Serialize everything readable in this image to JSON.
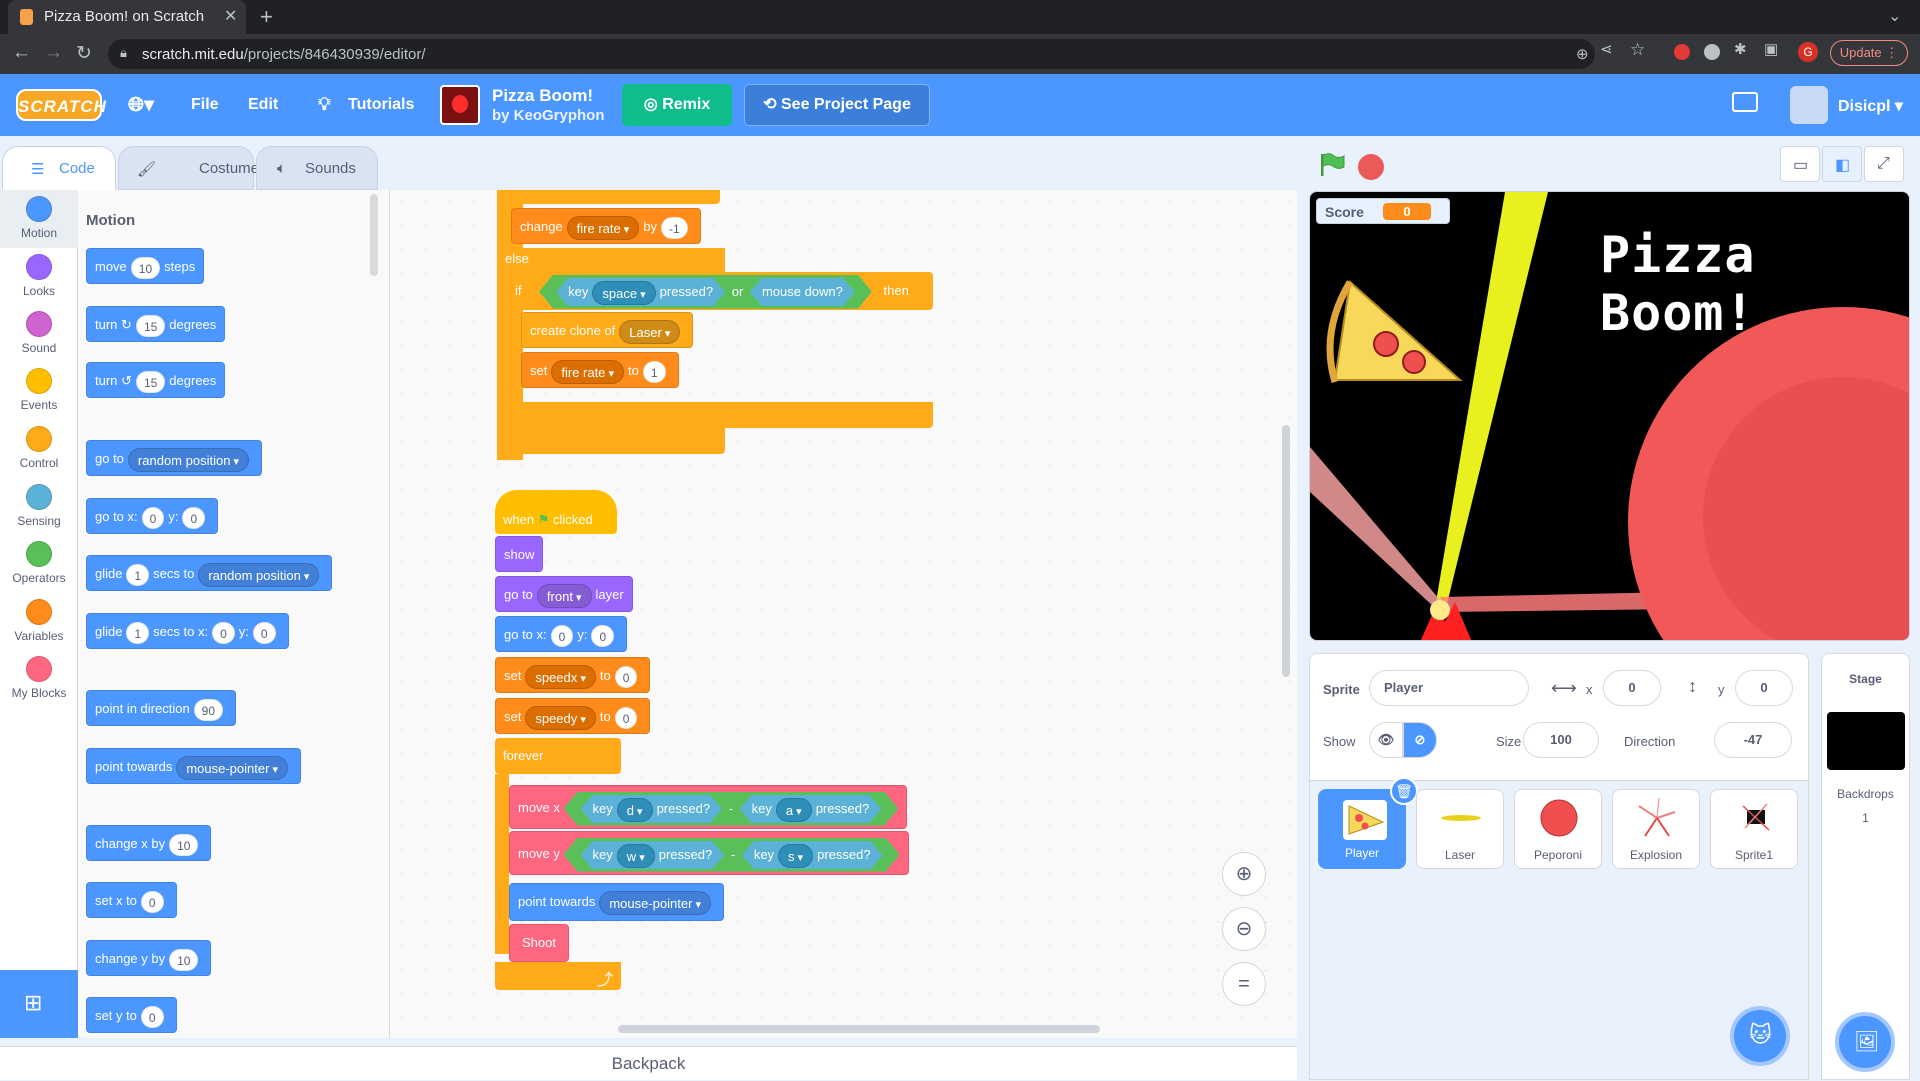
{
  "browser": {
    "tab_title": "Pizza Boom! on Scratch",
    "url_host": "scratch.mit.edu",
    "url_path": "/projects/846430939/editor/",
    "update_label": "Update",
    "profile_initial": "G"
  },
  "menu": {
    "logo": "SCRATCH",
    "file": "File",
    "edit": "Edit",
    "tutorials": "Tutorials",
    "project_title": "Pizza Boom!",
    "project_author": "by KeoGryphon",
    "remix": "Remix",
    "see_project": "See Project Page",
    "username": "Disicpl"
  },
  "editor_tabs": {
    "code": "Code",
    "costumes": "Costumes",
    "sounds": "Sounds"
  },
  "categories": [
    {
      "label": "Motion",
      "color": "#4c97ff"
    },
    {
      "label": "Looks",
      "color": "#9966ff"
    },
    {
      "label": "Sound",
      "color": "#cf63cf"
    },
    {
      "label": "Events",
      "color": "#ffbf00"
    },
    {
      "label": "Control",
      "color": "#ffab19"
    },
    {
      "label": "Sensing",
      "color": "#5cb1d6"
    },
    {
      "label": "Operators",
      "color": "#59c059"
    },
    {
      "label": "Variables",
      "color": "#ff8c1a"
    },
    {
      "label": "My Blocks",
      "color": "#ff6680"
    }
  ],
  "palette": {
    "title": "Motion",
    "move": {
      "a": "move",
      "v": "10",
      "b": "steps"
    },
    "turn_cw": {
      "a": "turn",
      "v": "15",
      "b": "degrees"
    },
    "turn_ccw": {
      "a": "turn",
      "v": "15",
      "b": "degrees"
    },
    "goto": {
      "a": "go to",
      "dd": "random position"
    },
    "gotoxy": {
      "a": "go to x:",
      "x": "0",
      "b": "y:",
      "y": "0"
    },
    "glide_to": {
      "a": "glide",
      "v": "1",
      "b": "secs to",
      "dd": "random position"
    },
    "glide_xy": {
      "a": "glide",
      "v": "1",
      "b": "secs to x:",
      "x": "0",
      "c": "y:",
      "y": "0"
    },
    "point_dir": {
      "a": "point in direction",
      "v": "90"
    },
    "point_towards": {
      "a": "point towards",
      "dd": "mouse-pointer"
    },
    "change_x": {
      "a": "change x by",
      "v": "10"
    },
    "set_x": {
      "a": "set x to",
      "v": "0"
    },
    "change_y": {
      "a": "change y by",
      "v": "10"
    },
    "set_y": {
      "a": "set y to",
      "v": "0"
    }
  },
  "script1": {
    "change_fire": {
      "a": "change",
      "dd": "fire rate",
      "b": "by",
      "v": "-1"
    },
    "else": "else",
    "if": {
      "a": "if",
      "key": "key",
      "key_dd": "space",
      "pressed": "pressed?",
      "or": "or",
      "mouse": "mouse down?",
      "then": "then"
    },
    "clone": {
      "a": "create clone of",
      "dd": "Laser"
    },
    "set_fire": {
      "a": "set",
      "dd": "fire rate",
      "b": "to",
      "v": "1"
    }
  },
  "script2": {
    "when": "when",
    "clicked": "clicked",
    "show": "show",
    "goto_layer": {
      "a": "go to",
      "dd": "front",
      "b": "layer"
    },
    "gotoxy": {
      "a": "go to x:",
      "x": "0",
      "b": "y:",
      "y": "0"
    },
    "set_speedx": {
      "a": "set",
      "dd": "speedx",
      "b": "to",
      "v": "0"
    },
    "set_speedy": {
      "a": "set",
      "dd": "speedy",
      "b": "to",
      "v": "0"
    },
    "forever": "forever",
    "move_x": {
      "a": "move x",
      "k1": "key",
      "d1": "d",
      "p1": "pressed?",
      "minus": "-",
      "k2": "key",
      "d2": "a",
      "p2": "pressed?"
    },
    "move_y": {
      "a": "move y",
      "k1": "key",
      "d1": "w",
      "p1": "pressed?",
      "minus": "-",
      "k2": "key",
      "d2": "s",
      "p2": "pressed?"
    },
    "point_towards": {
      "a": "point towards",
      "dd": "mouse-pointer"
    },
    "shoot": "Shoot"
  },
  "backpack": "Backpack",
  "stage": {
    "score_label": "Score",
    "score_value": "0",
    "game_title": "Pizza Boom!"
  },
  "sprite_info": {
    "sprite_label": "Sprite",
    "sprite_name": "Player",
    "x_label": "x",
    "x": "0",
    "y_label": "y",
    "y": "0",
    "show_label": "Show",
    "size_label": "Size",
    "size": "100",
    "direction_label": "Direction",
    "direction": "-47"
  },
  "sprites": [
    "Player",
    "Laser",
    "Peporoni",
    "Explosion",
    "Sprite1"
  ],
  "stage_panel": {
    "title": "Stage",
    "backdrops_label": "Backdrops",
    "backdrops_count": "1"
  }
}
